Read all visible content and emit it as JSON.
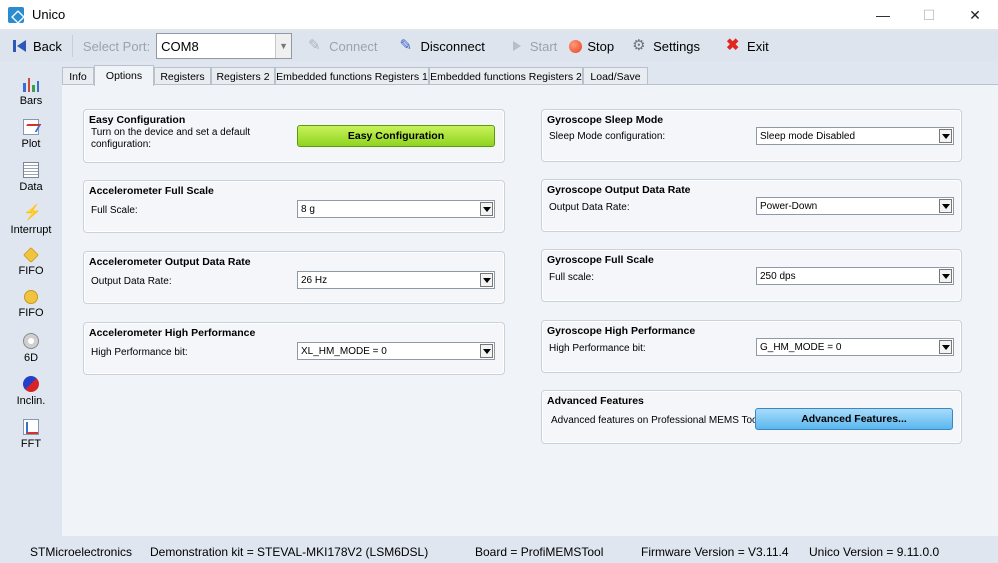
{
  "window": {
    "title": "Unico"
  },
  "toolbar": {
    "back": "Back",
    "port_label": "Select Port:",
    "port_value": "COM8",
    "connect": "Connect",
    "disconnect": "Disconnect",
    "start": "Start",
    "stop": "Stop",
    "settings": "Settings",
    "exit": "Exit"
  },
  "sidebar": {
    "items": [
      "Bars",
      "Plot",
      "Data",
      "Interrupt",
      "FIFO",
      "FIFO",
      "6D",
      "Inclin.",
      "FFT"
    ]
  },
  "tabs": [
    "Info",
    "Options",
    "Registers",
    "Registers 2",
    "Embedded functions Registers 1",
    "Embedded functions Registers 2",
    "Load/Save"
  ],
  "active_tab": "Options",
  "left_groups": {
    "easy": {
      "title": "Easy Configuration",
      "label": "Turn on the device and set a default configuration:",
      "button": "Easy Configuration"
    },
    "acc_fs": {
      "title": "Accelerometer Full Scale",
      "label": "Full Scale:",
      "value": "8 g"
    },
    "acc_odr": {
      "title": "Accelerometer Output Data Rate",
      "label": "Output Data Rate:",
      "value": "26 Hz"
    },
    "acc_hp": {
      "title": "Accelerometer High Performance",
      "label": "High Performance bit:",
      "value": "XL_HM_MODE = 0"
    }
  },
  "right_groups": {
    "gyro_sleep": {
      "title": "Gyroscope Sleep Mode",
      "label": "Sleep Mode configuration:",
      "value": "Sleep mode Disabled"
    },
    "gyro_odr": {
      "title": "Gyroscope Output Data Rate",
      "label": "Output Data Rate:",
      "value": "Power-Down"
    },
    "gyro_fs": {
      "title": "Gyroscope Full Scale",
      "label": "Full scale:",
      "value": "250 dps"
    },
    "gyro_hp": {
      "title": "Gyroscope High Performance",
      "label": "High Performance bit:",
      "value": "G_HM_MODE = 0"
    },
    "advanced": {
      "title": "Advanced Features",
      "label": "Advanced features on Professional MEMS Tool",
      "button": "Advanced Features..."
    }
  },
  "status": {
    "vendor": "STMicroelectronics",
    "kit": "Demonstration kit = STEVAL-MKI178V2 (LSM6DSL)",
    "board": "Board = ProfiMEMSTool",
    "firmware": "Firmware Version = V3.11.4",
    "unico": "Unico Version = 9.11.0.0"
  }
}
